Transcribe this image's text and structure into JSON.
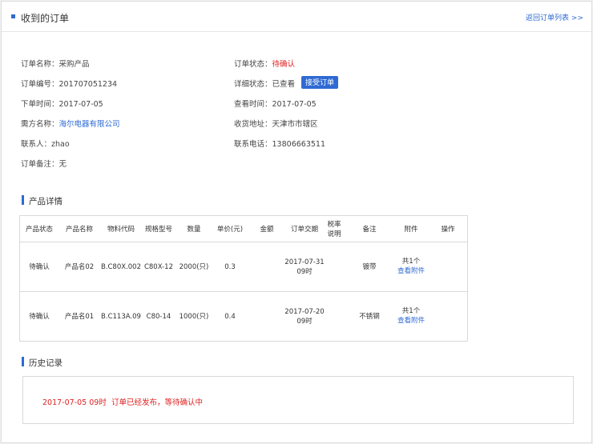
{
  "header": {
    "title": "收到的订单",
    "back_link": "返回订单列表 >>"
  },
  "order": {
    "name_label": "订单名称：",
    "name": "采购产品",
    "status_label": "订单状态：",
    "status": "待确认",
    "number_label": "订单编号：",
    "number": "201707051234",
    "detail_status_label": "详细状态：",
    "detail_status": "已查看",
    "accept_button": "接受订单",
    "order_time_label": "下单时间：",
    "order_time": "2017-07-05",
    "view_time_label": "查看时间：",
    "view_time": "2017-07-05",
    "buyer_label": "需方名称：",
    "buyer": "海尔电器有限公司",
    "address_label": "收货地址：",
    "address": "天津市市辖区",
    "contact_label": "联系人：",
    "contact": "zhao",
    "phone_label": "联系电话：",
    "phone": "13806663511",
    "remark_label": "订单备注：",
    "remark": "无"
  },
  "products": {
    "section_title": "产品详情",
    "columns": [
      "产品状态",
      "产品名称",
      "物料代码",
      "规格型号",
      "数量",
      "单价(元)",
      "金额",
      "订单交期",
      "税率",
      "说明",
      "备注",
      "附件",
      "操作"
    ],
    "rows": [
      {
        "status": "待确认",
        "name": "产品名02",
        "code": "B.C80X.002",
        "spec": "C80X-12",
        "qty": "2000(只)",
        "price": "0.3",
        "amount": "",
        "delivery_date": "2017-07-31",
        "delivery_time": "09时",
        "remark": "镀带",
        "attach_count": "共1个",
        "attach_link": "查看附件"
      },
      {
        "status": "待确认",
        "name": "产品名01",
        "code": "B.C113A.09",
        "spec": "C80-14",
        "qty": "1000(只)",
        "price": "0.4",
        "amount": "",
        "delivery_date": "2017-07-20",
        "delivery_time": "09时",
        "remark": "不锈钢",
        "attach_count": "共1个",
        "attach_link": "查看附件"
      }
    ]
  },
  "history": {
    "section_title": "历史记录",
    "entries": [
      {
        "time": "2017-07-05 09时",
        "message": "订单已经发布，等待确认中"
      }
    ]
  },
  "colors": {
    "accent": "#2f6ad3",
    "status_red": "#e02020"
  }
}
